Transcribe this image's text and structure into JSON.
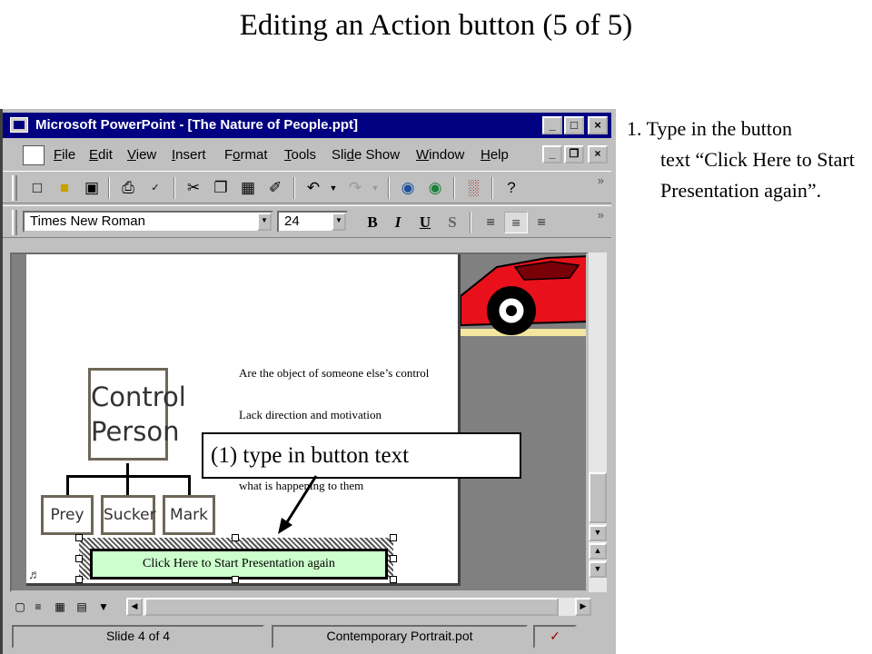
{
  "slide": {
    "title": "Editing an Action button  (5 of 5)",
    "step_first": "1. Type in the button",
    "step_rest": "text “Click Here to Start Presentation again”."
  },
  "window": {
    "title": "Microsoft PowerPoint - [The Nature of People.ppt]",
    "controls": {
      "minimize": "_",
      "maximize": "□",
      "close": "×",
      "restore": "❐"
    }
  },
  "menu": {
    "items": [
      {
        "pre": "",
        "u": "F",
        "post": "ile"
      },
      {
        "pre": "",
        "u": "E",
        "post": "dit"
      },
      {
        "pre": "",
        "u": "V",
        "post": "iew"
      },
      {
        "pre": "",
        "u": "I",
        "post": "nsert"
      },
      {
        "pre": "F",
        "u": "o",
        "post": "rmat"
      },
      {
        "pre": "",
        "u": "T",
        "post": "ools"
      },
      {
        "pre": "Sli",
        "u": "d",
        "post": "e Show"
      },
      {
        "pre": "",
        "u": "W",
        "post": "indow"
      },
      {
        "pre": "",
        "u": "H",
        "post": "elp"
      }
    ]
  },
  "formatting": {
    "font_name": "Times New Roman",
    "font_size": "24",
    "bold": "B",
    "italic": "I",
    "underline": "U",
    "shadow": "S"
  },
  "slide_content": {
    "org_control": "Control Person",
    "org_prey": "Prey",
    "org_sucker": "Sucker",
    "org_mark": "Mark",
    "bullet_1": "Are the object of someone else’s control",
    "bullet_2": "Lack direction and motivation",
    "bullet_3": "what is happening to them",
    "action_button": "Click Here to Start Presentation again"
  },
  "status": {
    "slide_count": "Slide 4 of 4",
    "design": "Contemporary Portrait.pot"
  },
  "callout": {
    "text": "(1) type in button text"
  },
  "icons": {
    "new": "new-document-icon",
    "open": "open-folder-icon",
    "save": "save-icon",
    "print": "print-icon",
    "spelling": "spelling-icon",
    "cut": "cut-icon",
    "copy": "copy-icon",
    "paste": "paste-icon",
    "format_painter": "format-painter-icon",
    "undo": "undo-icon",
    "redo": "redo-icon",
    "hyperlink": "insert-hyperlink-icon",
    "web": "web-toolbar-icon",
    "chart": "insert-chart-icon",
    "help": "office-assistant-icon"
  },
  "colors": {
    "titlebar": "#000080",
    "chrome": "#c0c0c0",
    "workspace": "#808080",
    "button_fill": "#ccffcc",
    "car": "#e8101a"
  }
}
